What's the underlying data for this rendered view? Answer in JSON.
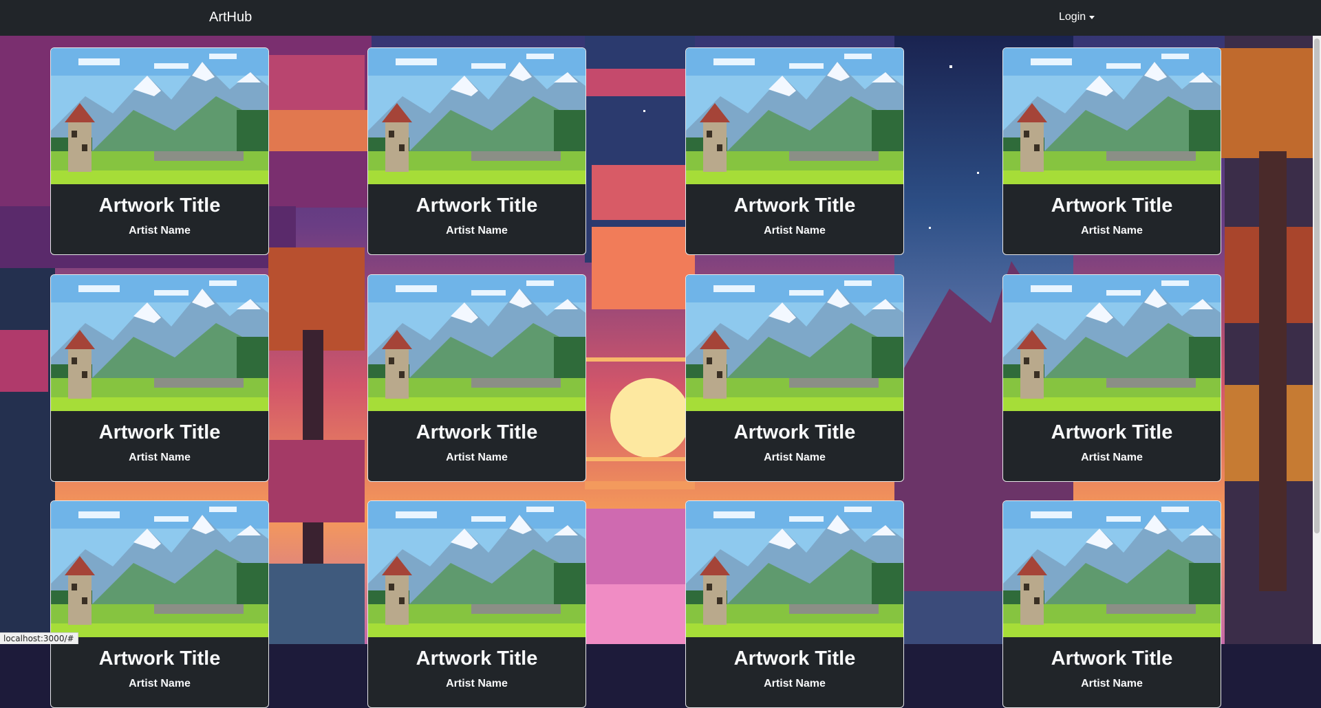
{
  "navbar": {
    "brand": "ArtHub",
    "login_label": "Login"
  },
  "artworks": [
    {
      "title": "Artwork Title",
      "artist": "Artist Name"
    },
    {
      "title": "Artwork Title",
      "artist": "Artist Name"
    },
    {
      "title": "Artwork Title",
      "artist": "Artist Name"
    },
    {
      "title": "Artwork Title",
      "artist": "Artist Name"
    },
    {
      "title": "Artwork Title",
      "artist": "Artist Name"
    },
    {
      "title": "Artwork Title",
      "artist": "Artist Name"
    },
    {
      "title": "Artwork Title",
      "artist": "Artist Name"
    },
    {
      "title": "Artwork Title",
      "artist": "Artist Name"
    },
    {
      "title": "Artwork Title",
      "artist": "Artist Name"
    },
    {
      "title": "Artwork Title",
      "artist": "Artist Name"
    },
    {
      "title": "Artwork Title",
      "artist": "Artist Name"
    },
    {
      "title": "Artwork Title",
      "artist": "Artist Name"
    }
  ],
  "status_bar": {
    "url": "localhost:3000/#"
  },
  "colors": {
    "navbar_bg": "#212529",
    "card_bg": "#212529",
    "card_border": "#e8e8ea"
  }
}
